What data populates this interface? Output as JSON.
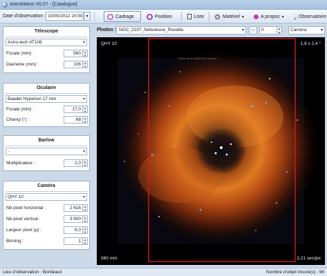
{
  "window": {
    "title": "AstroMatos V0.07 - [Catalogue]"
  },
  "toolbar": {
    "date_label": "Date d'observation :",
    "date_value": "10/05/2012 20:55",
    "cadrage": "Cadrage",
    "position": "Position",
    "liste": "Liste",
    "materiel": "Matériel",
    "apropos": "A propos",
    "observatoire": "Observatoire"
  },
  "telescope": {
    "title": "Télescope",
    "selected": "Astro-tech AT106",
    "focale_label": "Focale (mm) :",
    "focale": "560",
    "diametre_label": "Diamètre (mm) :",
    "diametre": "106"
  },
  "oculaire": {
    "title": "Oculaire",
    "selected": "Baader Hyperion 17 mm",
    "focale_label": "Focale (mm) :",
    "focale": "17,0",
    "champ_label": "Champ (°) :",
    "champ": "68"
  },
  "barlow": {
    "title": "Barlow",
    "selected": "-",
    "mult_label": "Multiplicateur :",
    "mult": "1,0"
  },
  "camera": {
    "title": "Caméra",
    "selected": "QHY 10",
    "nbx_label": "Nb pixel horizontal :",
    "nbx": "2 616",
    "nby_label": "Nb pixel vertical :",
    "nby": "3 900",
    "larg_label": "Largeur pixel (µ) :",
    "larg": "6,0",
    "bin_label": "Binning :",
    "bin": "1"
  },
  "photos": {
    "label": "Photos :",
    "selected": "NGC_2237_Nebuleuse_Rosette",
    "dots": "...",
    "number": "0",
    "view_mode": "Camera"
  },
  "viewer": {
    "camera_name": "QHY 10",
    "fov": "1,6 x 2,4 °",
    "focal": "560 mm",
    "sampling": "2,21 sec/pix",
    "watermark": "Cédric Brulé (Night Sky Survey)"
  },
  "status": {
    "location": "Lieu d'observation : Bordeaux",
    "count": "Nombre d'objet trouvé(s) : 96"
  },
  "colors": {
    "accent": "#7b95b8",
    "frame": "#d41c1c"
  }
}
